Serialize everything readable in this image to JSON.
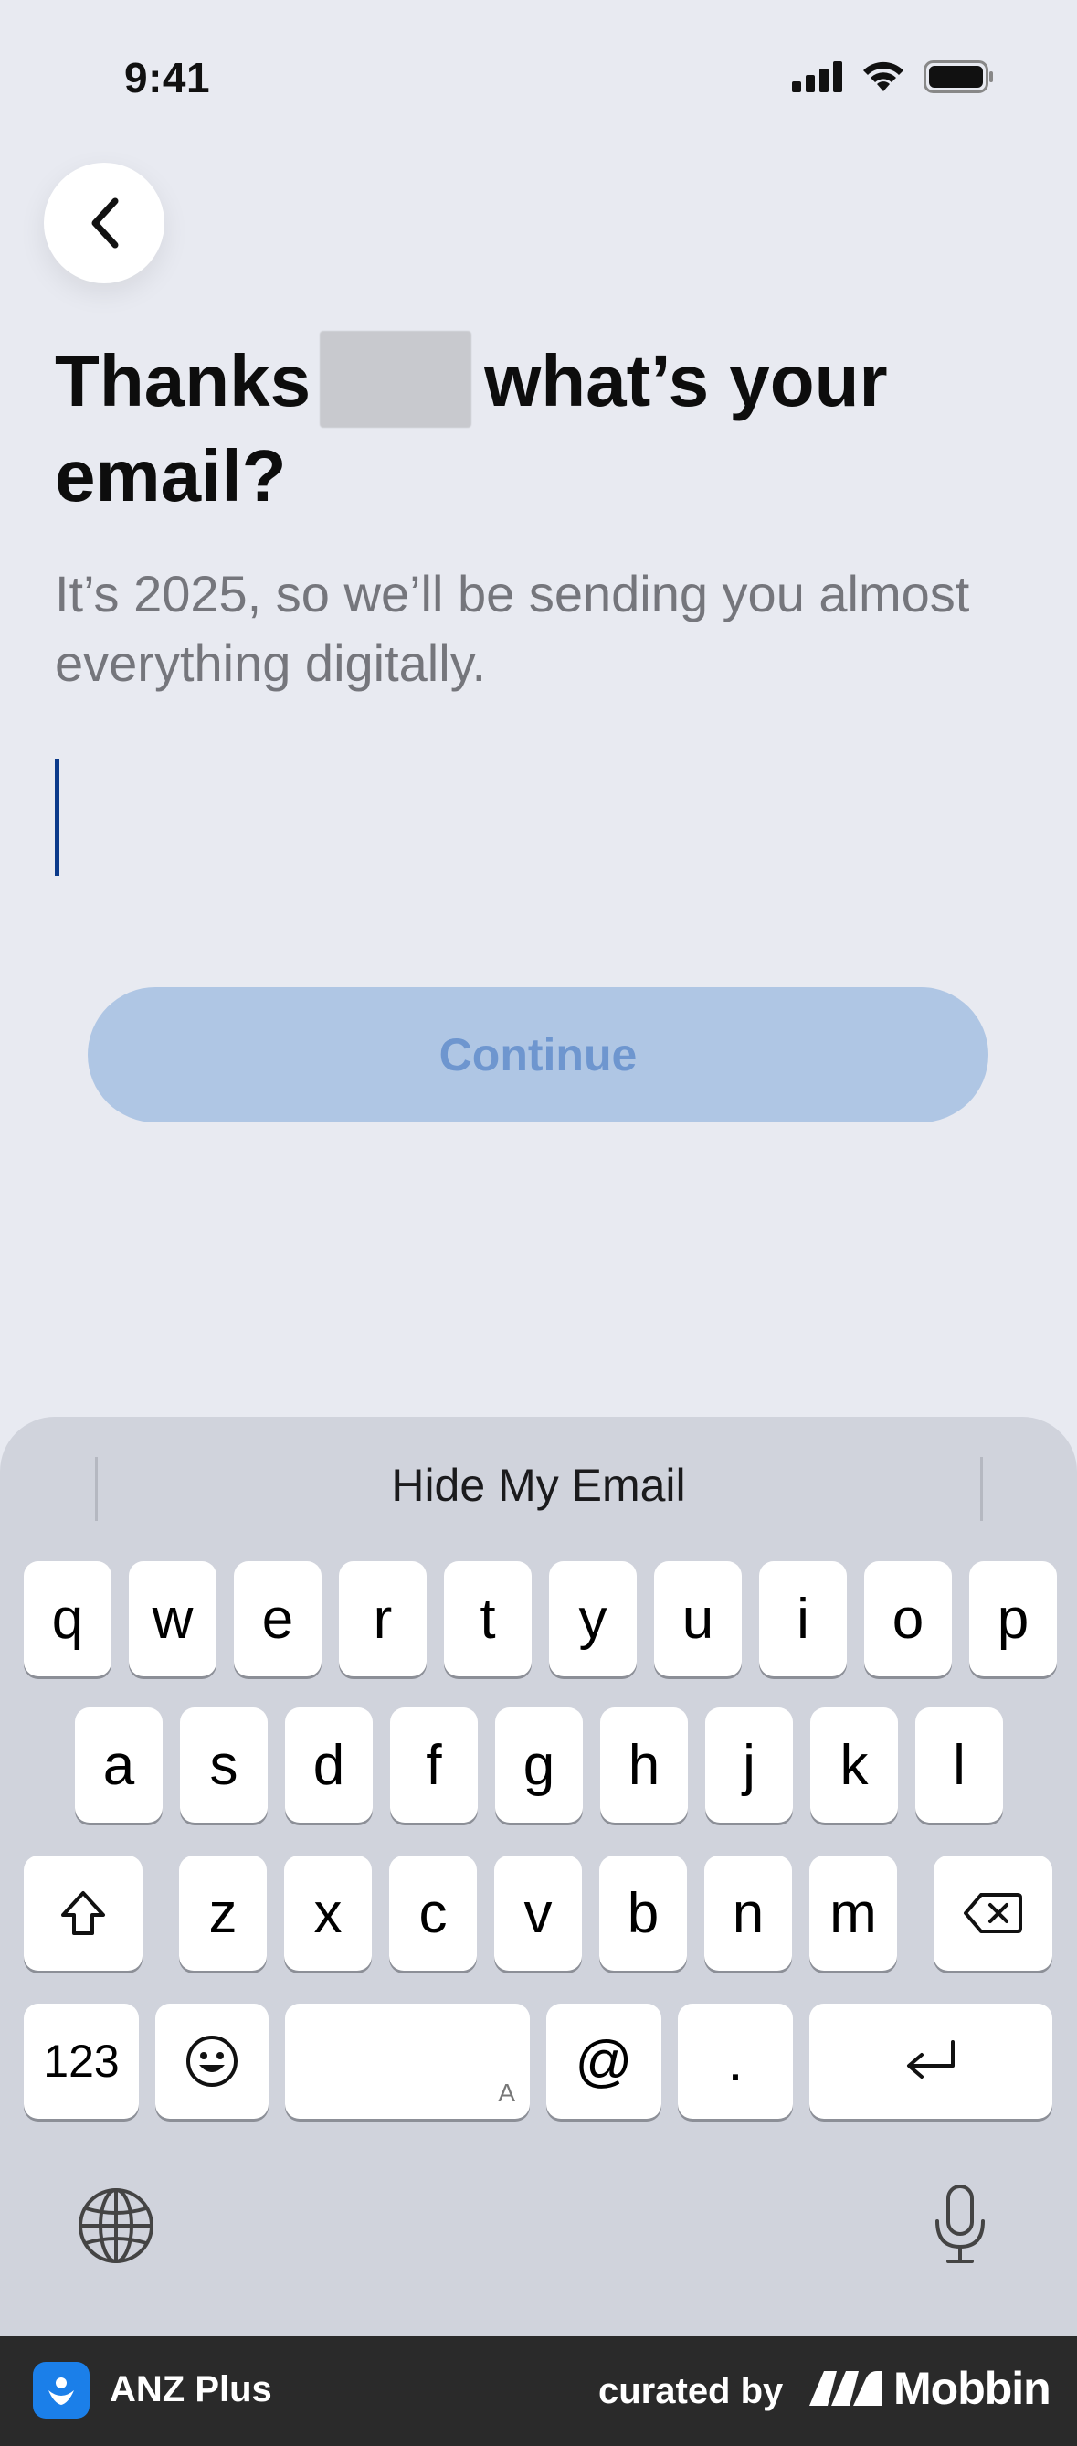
{
  "status": {
    "time": "9:41"
  },
  "heading": {
    "before": "Thanks",
    "after": "what’s your email?"
  },
  "subtitle": "It’s 2025, so we’ll be sending you almost everything digitally.",
  "continue_label": "Continue",
  "keyboard": {
    "suggestion": "Hide My Email",
    "row1": [
      "q",
      "w",
      "e",
      "r",
      "t",
      "y",
      "u",
      "i",
      "o",
      "p"
    ],
    "row2": [
      "a",
      "s",
      "d",
      "f",
      "g",
      "h",
      "j",
      "k",
      "l"
    ],
    "row3": [
      "z",
      "x",
      "c",
      "v",
      "b",
      "n",
      "m"
    ],
    "numbers_label": "123",
    "at_label": "@",
    "dot_label": ".",
    "space_hint": "A"
  },
  "footer": {
    "app_name": "ANZ Plus",
    "curated_by": "curated by",
    "brand": "Mobbin"
  },
  "colors": {
    "background": "#e8eaf1",
    "continue_bg": "#afc6e4",
    "continue_text": "#6e96cf",
    "caret": "#0b3a8a",
    "footer_bg": "#2a2a2a",
    "app_icon": "#1b7fe9"
  }
}
